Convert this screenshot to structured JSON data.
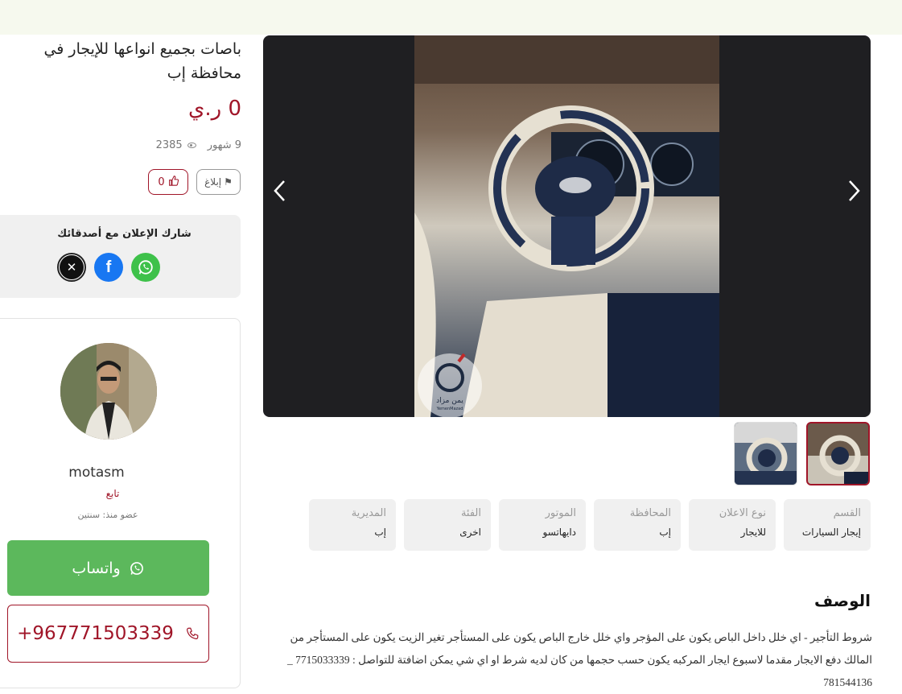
{
  "listing": {
    "title": "باصات بجميع انواعها للإيجار في محافظة إب",
    "price": "0 ر.ي",
    "age": "9 شهور",
    "views": "2385",
    "report_label": "إبلاغ",
    "likes": "0"
  },
  "share": {
    "title": "شارك الإعلان مع أصدقائك",
    "x_icon": "x-logo-icon",
    "facebook_icon": "facebook-icon",
    "whatsapp_icon": "whatsapp-icon"
  },
  "seller": {
    "username": "motasm",
    "follow_label": "تابع",
    "member_since": "عضو منذ: سنتين",
    "whatsapp_label": "واتساب",
    "phone": "+967771503339"
  },
  "gallery": {
    "watermark_ar": "يمن مزاد",
    "watermark_en": "YemenMazad",
    "thumbnails": 2,
    "selected_thumbnail": 2
  },
  "specs": [
    {
      "label": "القسم",
      "value": "إيجار السيارات"
    },
    {
      "label": "نوع الاعلان",
      "value": "للايجار"
    },
    {
      "label": "المحافظة",
      "value": "إب"
    },
    {
      "label": "الموتور",
      "value": "دايهاتسو"
    },
    {
      "label": "الفئة",
      "value": "اخرى"
    },
    {
      "label": "المديرية",
      "value": "إب"
    }
  ],
  "description": {
    "title": "الوصف",
    "text": "شروط التأجير - اي خلل داخل الباص يكون على المؤجر واي خلل خارج الباص يكون على المستأجر تغير الزيت يكون على المستأجر من المالك دفع الايجار مقدما لاسبوع ايجار المركبه يكون حسب حجمها من كان لديه شرط او اي شي يمكن اضافتة للتواصل : 7715033339 _ 781544136"
  },
  "colors": {
    "accent": "#a01528",
    "whatsapp": "#5cb85c",
    "topbar": "#f6f9ee"
  }
}
